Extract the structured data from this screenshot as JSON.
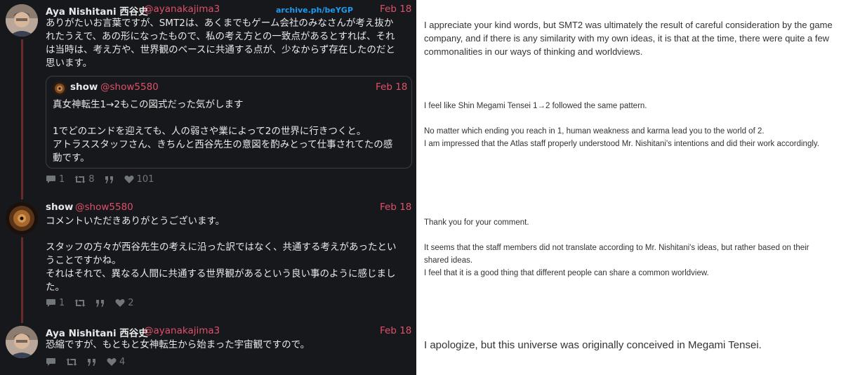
{
  "archive_link": "archive.ph/beYGP",
  "tweets": [
    {
      "name": "Aya Nishitani 西谷史",
      "handle": "@ayanakajima3",
      "date": "Feb 18",
      "lines": [
        "ありがたいお言葉ですが、SMT2は、あくまでもゲーム会社のみなさんが考え抜か",
        "れたうえで、あの形になったもので、私の考え方との一致点があるとすれば、それ",
        "は当時は、考え方や、世界観のベースに共通する点が、少なからず存在したのだと",
        "思います。"
      ],
      "quote": {
        "name": "show",
        "handle": "@show5580",
        "date": "Feb 18",
        "line1": "真女神転生1→2もこの図式だった気がします",
        "line2": "1でどのエンドを迎えても、人の弱さや業によって2の世界に行きつくと。",
        "line3": "アトラススタッフさん、きちんと西谷先生の意図を酌みとって仕事されてたの感",
        "line4": "動です。"
      },
      "stats": {
        "replies": "1",
        "retweets": "8",
        "likes": "101"
      }
    },
    {
      "name": "show",
      "handle": "@show5580",
      "date": "Feb 18",
      "line1": "コメントいただきありがとうございます。",
      "line2": "スタッフの方々が西谷先生の考えに沿った訳ではなく、共通する考えがあったとい",
      "line3": "うことですかね。",
      "line4": "それはそれで、異なる人間に共通する世界観があるという良い事のように感じまし",
      "line5": "た。",
      "stats": {
        "replies": "1",
        "retweets": "",
        "likes": "2"
      }
    },
    {
      "name": "Aya Nishitani 西谷史",
      "handle": "@ayanakajima3",
      "date": "Feb 18",
      "line1": "恐縮ですが、もともと女神転生から始まった宇宙観ですので。",
      "stats": {
        "replies": "",
        "retweets": "",
        "likes": "4"
      }
    }
  ],
  "translations": {
    "t1": [
      "I appreciate your kind words, but SMT2 was ultimately the result of careful consideration by the game",
      "company, and if there is any similarity with my own ideas, it is that at the time, there were quite a few",
      "commonalities in our ways of thinking and worldviews."
    ],
    "q1": "I feel like Shin Megami Tensei 1→2 followed the same pattern.",
    "q2": "No matter which ending you reach in 1, human weakness and karma lead you to the world of 2.",
    "q3": "I am impressed that the Atlas staff properly understood Mr. Nishitani's intentions and did their work accordingly.",
    "t2a": "Thank you for your comment.",
    "t2b": "It seems that the staff members did not translate according to Mr. Nishitani's ideas, but rather based on their",
    "t2c": "shared ideas.",
    "t2d": "I feel that it is a good thing that different people can share a common worldview.",
    "t3": "I apologize, but this universe was originally conceived in Megami Tensei."
  },
  "colors": {
    "accent": "#e0506a",
    "link": "#1d9bf0",
    "background_dark": "#16181c",
    "thread_line": "#6b2a2a"
  }
}
